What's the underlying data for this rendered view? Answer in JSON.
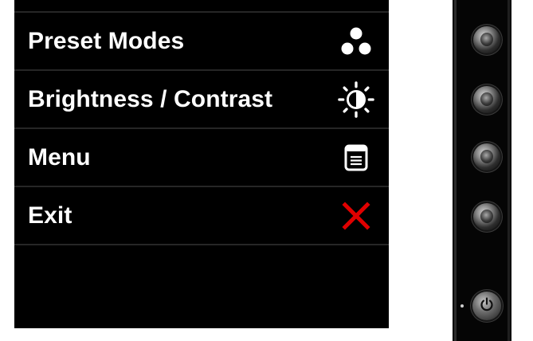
{
  "osd_menu": {
    "items": [
      {
        "label": "Preset Modes",
        "icon": "preset-modes-icon"
      },
      {
        "label": "Brightness / Contrast",
        "icon": "brightness-contrast-icon"
      },
      {
        "label": "Menu",
        "icon": "menu-icon"
      },
      {
        "label": "Exit",
        "icon": "exit-x-icon"
      }
    ],
    "colors": {
      "panel_background": "#000000",
      "label_text": "#ffffff",
      "exit_icon": "#e00000",
      "divider": "#262626"
    }
  },
  "monitor_bezel": {
    "buttons": [
      {
        "icon": "round-button-icon"
      },
      {
        "icon": "round-button-icon"
      },
      {
        "icon": "round-button-icon"
      },
      {
        "icon": "round-button-icon"
      },
      {
        "icon": "power-icon"
      }
    ],
    "colors": {
      "bezel": "#050505"
    }
  }
}
